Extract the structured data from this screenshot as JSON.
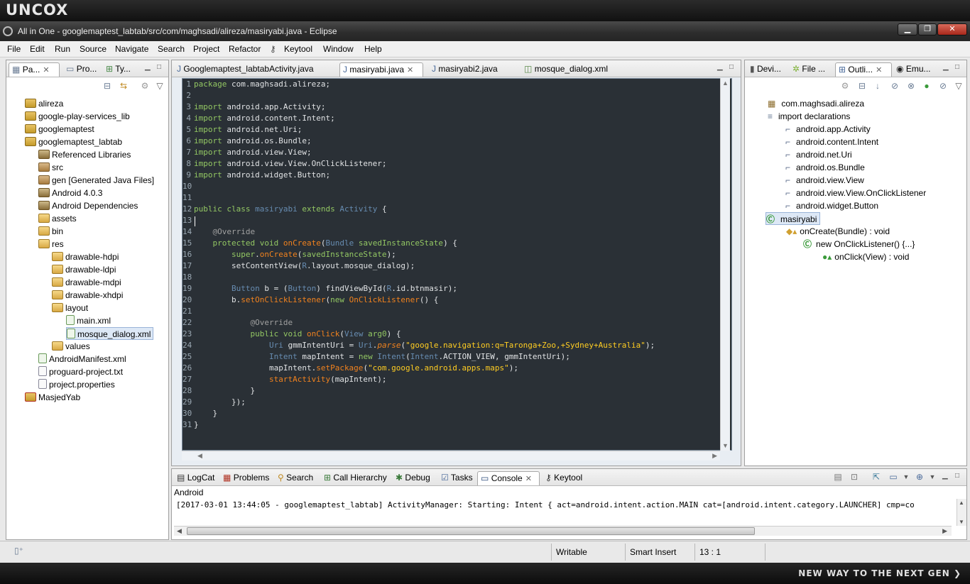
{
  "branding": {
    "logo_text": "UNCOX",
    "tagline": "NEW WAY TO THE NEXT GEN ❯"
  },
  "window": {
    "title": "All in One - googlemaptest_labtab/src/com/maghsadi/alireza/masiryabi.java - Eclipse",
    "minimize": "▁",
    "maximize": "❐",
    "close": "✕"
  },
  "menu": [
    "File",
    "Edit",
    "Run",
    "Source",
    "Navigate",
    "Search",
    "Project",
    "Refactor",
    "Keytool",
    "Window",
    "Help"
  ],
  "left_panel": {
    "tabs": [
      {
        "label": "Pa...",
        "active": true
      },
      {
        "label": "Pro...",
        "active": false
      },
      {
        "label": "Ty...",
        "active": false
      }
    ],
    "tree": [
      {
        "label": "alireza",
        "depth": 0,
        "icon": "project-icon"
      },
      {
        "label": "google-play-services_lib",
        "depth": 0,
        "icon": "project-icon"
      },
      {
        "label": "googlemaptest",
        "depth": 0,
        "icon": "project-icon"
      },
      {
        "label": "googlemaptest_labtab",
        "depth": 0,
        "icon": "project-icon"
      },
      {
        "label": "Referenced Libraries",
        "depth": 1,
        "icon": "library-icon"
      },
      {
        "label": "src",
        "depth": 1,
        "icon": "package-folder-icon"
      },
      {
        "label": "gen [Generated Java Files]",
        "depth": 1,
        "icon": "package-folder-icon"
      },
      {
        "label": "Android 4.0.3",
        "depth": 1,
        "icon": "library-icon"
      },
      {
        "label": "Android Dependencies",
        "depth": 1,
        "icon": "library-icon"
      },
      {
        "label": "assets",
        "depth": 1,
        "icon": "folder-icon"
      },
      {
        "label": "bin",
        "depth": 1,
        "icon": "folder-icon"
      },
      {
        "label": "res",
        "depth": 1,
        "icon": "folder-icon"
      },
      {
        "label": "drawable-hdpi",
        "depth": 2,
        "icon": "folder-icon"
      },
      {
        "label": "drawable-ldpi",
        "depth": 2,
        "icon": "folder-icon"
      },
      {
        "label": "drawable-mdpi",
        "depth": 2,
        "icon": "folder-icon"
      },
      {
        "label": "drawable-xhdpi",
        "depth": 2,
        "icon": "folder-icon"
      },
      {
        "label": "layout",
        "depth": 2,
        "icon": "folder-icon"
      },
      {
        "label": "main.xml",
        "depth": 3,
        "icon": "xml-file-icon"
      },
      {
        "label": "mosque_dialog.xml",
        "depth": 3,
        "icon": "xml-file-icon",
        "selected": true
      },
      {
        "label": "values",
        "depth": 2,
        "icon": "folder-icon"
      },
      {
        "label": "AndroidManifest.xml",
        "depth": 1,
        "icon": "xml-file-icon"
      },
      {
        "label": "proguard-project.txt",
        "depth": 1,
        "icon": "file-icon"
      },
      {
        "label": "project.properties",
        "depth": 1,
        "icon": "file-icon"
      },
      {
        "label": "MasjedYab",
        "depth": 0,
        "icon": "error-project-icon"
      }
    ]
  },
  "editor": {
    "tabs": [
      {
        "label": "Googlemaptest_labtabActivity.java",
        "active": false
      },
      {
        "label": "masiryabi.java",
        "active": true
      },
      {
        "label": "masiryabi2.java",
        "active": false
      },
      {
        "label": "mosque_dialog.xml",
        "active": false
      }
    ],
    "lines": [
      {
        "n": "1",
        "code": "package com.maghsadi.alireza;"
      },
      {
        "n": "2",
        "code": ""
      },
      {
        "n": "3",
        "code": "import android.app.Activity;"
      },
      {
        "n": "4",
        "code": "import android.content.Intent;"
      },
      {
        "n": "5",
        "code": "import android.net.Uri;"
      },
      {
        "n": "6",
        "code": "import android.os.Bundle;"
      },
      {
        "n": "7",
        "code": "import android.view.View;"
      },
      {
        "n": "8",
        "code": "import android.view.View.OnClickListener;"
      },
      {
        "n": "9",
        "code": "import android.widget.Button;"
      },
      {
        "n": "10",
        "code": ""
      },
      {
        "n": "11",
        "code": ""
      },
      {
        "n": "12",
        "code": "public class masiryabi extends Activity {"
      },
      {
        "n": "13",
        "code": ""
      },
      {
        "n": "14",
        "code": "    @Override"
      },
      {
        "n": "15",
        "code": "    protected void onCreate(Bundle savedInstanceState) {"
      },
      {
        "n": "16",
        "code": "        super.onCreate(savedInstanceState);"
      },
      {
        "n": "17",
        "code": "        setContentView(R.layout.mosque_dialog);"
      },
      {
        "n": "18",
        "code": ""
      },
      {
        "n": "19",
        "code": "        Button b = (Button) findViewById(R.id.btnmasir);"
      },
      {
        "n": "20",
        "code": "        b.setOnClickListener(new OnClickListener() {"
      },
      {
        "n": "21",
        "code": ""
      },
      {
        "n": "22",
        "code": "            @Override"
      },
      {
        "n": "23",
        "code": "            public void onClick(View arg0) {"
      },
      {
        "n": "24",
        "code": "                Uri gmmIntentUri = Uri.parse(\"google.navigation:q=Taronga+Zoo,+Sydney+Australia\");"
      },
      {
        "n": "25",
        "code": "                Intent mapIntent = new Intent(Intent.ACTION_VIEW, gmmIntentUri);"
      },
      {
        "n": "26",
        "code": "                mapIntent.setPackage(\"com.google.android.apps.maps\");"
      },
      {
        "n": "27",
        "code": "                startActivity(mapIntent);"
      },
      {
        "n": "28",
        "code": "            }"
      },
      {
        "n": "29",
        "code": "        });"
      },
      {
        "n": "30",
        "code": "    }"
      },
      {
        "n": "31",
        "code": "}"
      }
    ]
  },
  "right_panel": {
    "tabs": [
      {
        "label": "Devi...",
        "active": false
      },
      {
        "label": "File ...",
        "active": false
      },
      {
        "label": "Outli...",
        "active": true
      },
      {
        "label": "Emu...",
        "active": false
      }
    ],
    "outline": [
      {
        "label": "com.maghsadi.alireza",
        "depth": 0
      },
      {
        "label": "import declarations",
        "depth": 0
      },
      {
        "label": "android.app.Activity",
        "depth": 1
      },
      {
        "label": "android.content.Intent",
        "depth": 1
      },
      {
        "label": "android.net.Uri",
        "depth": 1
      },
      {
        "label": "android.os.Bundle",
        "depth": 1
      },
      {
        "label": "android.view.View",
        "depth": 1
      },
      {
        "label": "android.view.View.OnClickListener",
        "depth": 1
      },
      {
        "label": "android.widget.Button",
        "depth": 1
      },
      {
        "label": "masiryabi",
        "depth": 0,
        "selected": true
      },
      {
        "label": "onCreate(Bundle) : void",
        "depth": 1
      },
      {
        "label": "new OnClickListener() {...}",
        "depth": 2
      },
      {
        "label": "onClick(View) : void",
        "depth": 3
      }
    ]
  },
  "bottom_panel": {
    "tabs": [
      {
        "label": "LogCat",
        "active": false
      },
      {
        "label": "Problems",
        "active": false
      },
      {
        "label": "Search",
        "active": false
      },
      {
        "label": "Call Hierarchy",
        "active": false
      },
      {
        "label": "Debug",
        "active": false
      },
      {
        "label": "Tasks",
        "active": false
      },
      {
        "label": "Console",
        "active": true
      },
      {
        "label": "Keytool",
        "active": false
      }
    ],
    "console_title": "Android",
    "console_line": "[2017-03-01 13:44:05 - googlemaptest_labtab] ActivityManager: Starting: Intent { act=android.intent.action.MAIN cat=[android.intent.category.LAUNCHER] cmp=co"
  },
  "status": {
    "writable": "Writable",
    "insert_mode": "Smart Insert",
    "position": "13 : 1"
  }
}
